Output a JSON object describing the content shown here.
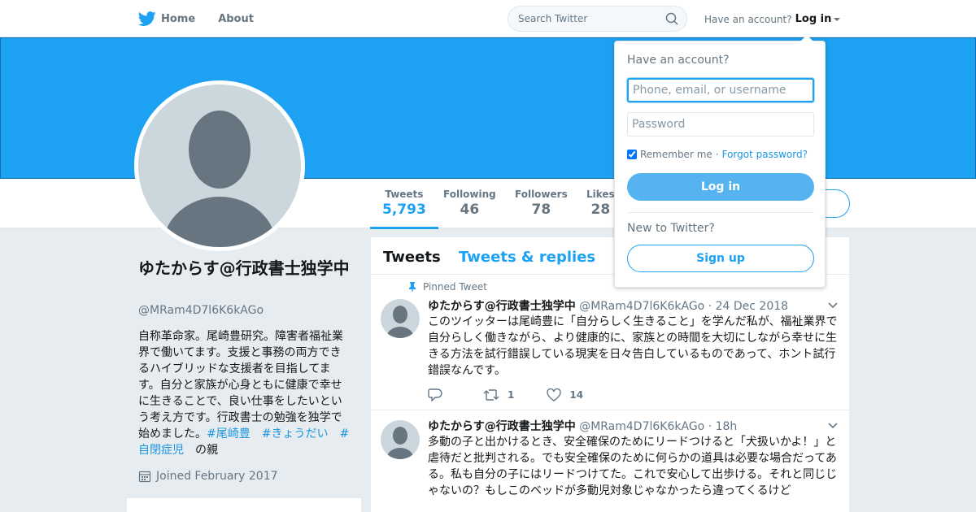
{
  "nav": {
    "home_label": "Home",
    "about_label": "About",
    "search_placeholder": "Search Twitter",
    "have_account": "Have an account?",
    "login_label": "Log in"
  },
  "colors": {
    "brand": "#1da1f2",
    "link": "#1b95e0"
  },
  "profile": {
    "name": "ゆたからす@行政書士独学中",
    "handle": "@MRam4D7l6K6kAGo",
    "bio_text": "自称革命家。尾崎豊研究。障害者福祉業界で働いてます。支援と事務の両方できるハイブリッドな支援者を目指してます。自分と家族が心身ともに健康で幸せに生きることで、良い仕事をしたいという考え方です。行政書士の勉強を独学で始めました。",
    "bio_tags": [
      "#尾崎豊",
      "#きょうだい",
      "#自閉症児"
    ],
    "bio_suffix": "の親",
    "joined": "Joined February 2017"
  },
  "stats": [
    {
      "label": "Tweets",
      "value": "5,793"
    },
    {
      "label": "Following",
      "value": "46"
    },
    {
      "label": "Followers",
      "value": "78"
    },
    {
      "label": "Likes",
      "value": "28"
    }
  ],
  "timeline": {
    "tab_tweets": "Tweets",
    "tab_replies": "Tweets & replies"
  },
  "tweets": [
    {
      "pinned_label": "Pinned Tweet",
      "name": "ゆたからす@行政書士独学中",
      "handle": "@MRam4D7l6K6kAGo",
      "time": "· 24 Dec 2018",
      "text": "このツイッターは尾崎豊に「自分らしく生きること」を学んだ私が、福祉業界で自分らしく働きながら、より健康的に、家族との時間を大切にしながら幸せに生きる方法を試行錯誤している現実を日々告白しているものであって、ホント試行錯誤なんです。",
      "retweets": "1",
      "likes": "14"
    },
    {
      "name": "ゆたからす@行政書士独学中",
      "handle": "@MRam4D7l6K6kAGo",
      "time": "· 18h",
      "text": "多動の子と出かけるとき、安全確保のためにリードつけると「犬扱いかよ！」と虐待だと批判される。でも安全確保のために何らかの道具は必要な場合だってある。私も自分の子にはリードつけてた。これで安心して出歩ける。それと同じじゃないの？もしこのベッドが多動児対象じゃなかったら違ってくるけど"
    }
  ],
  "login_dropdown": {
    "title": "Have an account?",
    "username_placeholder": "Phone, email, or username",
    "password_placeholder": "Password",
    "remember_label": "Remember me",
    "separator": "·",
    "forgot_label": "Forgot password?",
    "login_button": "Log in",
    "new_label": "New to Twitter?",
    "signup_button": "Sign up"
  }
}
